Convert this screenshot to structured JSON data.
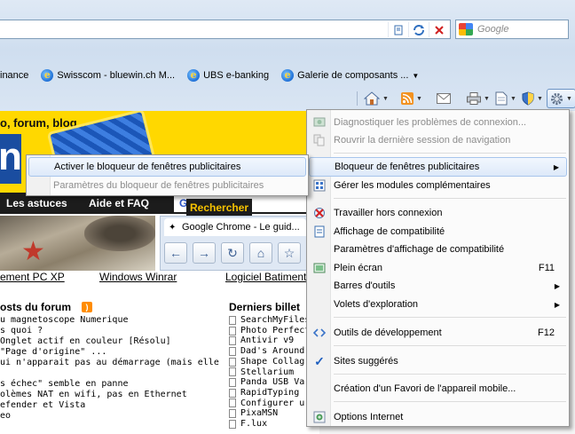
{
  "search": {
    "placeholder": "Google"
  },
  "favorites": [
    {
      "label": "inance"
    },
    {
      "label": "Swisscom - bluewin.ch M..."
    },
    {
      "label": "UBS e-banking"
    },
    {
      "label": "Galerie de composants ..."
    }
  ],
  "web": {
    "banner_text": "o, forum, blog...",
    "big_letter": "n",
    "nav": [
      "Les astuces",
      "Aide et FAQ"
    ],
    "google_search": {
      "logo": "Google",
      "tm": "™",
      "button": "Rechercher"
    },
    "chrome_tab_title": "Google Chrome - Le guid...",
    "links": [
      "ement PC XP",
      "Windows Winrar",
      "Logiciel Batiment"
    ],
    "posts_title": "osts du forum",
    "posts": [
      "u magnetoscope Numerique",
      "s quoi ?",
      "  Onglet actif en couleur [Résolu]",
      " \"Page d'origine\" ...",
      "ui n'apparait pas au démarrage (mais elle",
      "",
      "s échec\" semble en panne",
      "olèmes NAT en wifi, pas en Ethernet",
      "efender et Vista",
      "eo"
    ],
    "billets_title": "Derniers billet",
    "billets": [
      "SearchMyFiles",
      "Photo Perfect",
      "Antivir v9",
      "Dad's Around",
      "Shape Collag",
      "Stellarium",
      "Panda USB Va",
      "RapidTyping",
      "Configurer u",
      "PixaMSN",
      "F.lux"
    ]
  },
  "tools_menu": {
    "items": [
      {
        "label": "Diagnostiquer les problèmes de connexion...",
        "disabled": true,
        "icon": "diagnose-icon"
      },
      {
        "label": "Rouvrir la dernière session de navigation",
        "disabled": true,
        "icon": "reopen-session-icon"
      },
      {
        "label": "Bloqueur de fenêtres publicitaires",
        "highlighted": true,
        "submenu": true
      },
      {
        "label": "Gérer les modules complémentaires",
        "icon": "addons-icon"
      },
      {
        "label": "Travailler hors connexion",
        "icon": "offline-icon"
      },
      {
        "label": "Affichage de compatibilité",
        "icon": "compatibility-icon"
      },
      {
        "label": "Paramètres d'affichage de compatibilité"
      },
      {
        "label": "Plein écran",
        "shortcut": "F11",
        "icon": "fullscreen-icon"
      },
      {
        "label": "Barres d'outils",
        "submenu": true
      },
      {
        "label": "Volets d'exploration",
        "submenu": true
      },
      {
        "label": "Outils de développement",
        "shortcut": "F12",
        "icon": "developer-tools-icon"
      },
      {
        "label": "Sites suggérés",
        "checked": true
      },
      {
        "label": "Création d'un Favori de l'appareil mobile..."
      },
      {
        "label": "Options Internet",
        "icon": "internet-options-icon"
      }
    ]
  },
  "popup_submenu": {
    "items": [
      {
        "label": "Activer le bloqueur de fenêtres publicitaires",
        "highlighted": true
      },
      {
        "label": "Paramètres du bloqueur de fenêtres publicitaires",
        "disabled": true
      }
    ]
  },
  "colors": {
    "highlight_border": "#a7c5ec",
    "banner": "#ffd800",
    "navbar": "#1c1c1c"
  }
}
